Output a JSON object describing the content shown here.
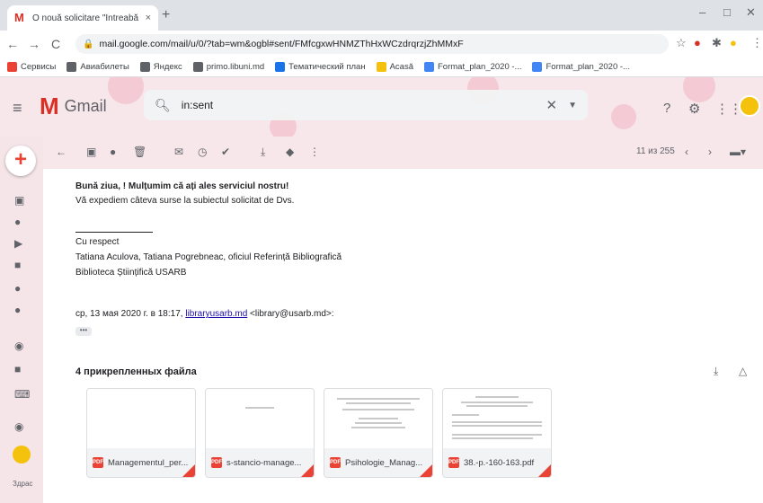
{
  "browser": {
    "tab_title": "O nouă solicitare \"Întreabă bibliot",
    "tab_close": "×",
    "new_tab": "+",
    "url": "mail.google.com/mail/u/0/?tab=wm&ogbl#sent/FMfcgxwHNMZThHxWCzdrqrzjZhMMxF",
    "back": "←",
    "forward": "→",
    "reload": "C",
    "minimize": "–",
    "maximize": "□",
    "close": "✕"
  },
  "bookmarks": [
    {
      "label": "Сервисы",
      "color": "#ea4335"
    },
    {
      "label": "Авиабилеты",
      "color": "#5f6368"
    },
    {
      "label": "Яндекс",
      "color": "#5f6368"
    },
    {
      "label": "primo.libuni.md",
      "color": "#5f6368"
    },
    {
      "label": "Тематический план",
      "color": "#1a73e8"
    },
    {
      "label": "Acasă",
      "color": "#f4c20d"
    },
    {
      "label": "Format_plan_2020 -...",
      "color": "#4285f4"
    },
    {
      "label": "Format_plan_2020 -...",
      "color": "#4285f4"
    }
  ],
  "gmail": {
    "logo_letter": "M",
    "logo_word": "Gmail",
    "search_value": "in:sent"
  },
  "toolbar": {
    "count": "11 из 255"
  },
  "message": {
    "line1": "Bună ziua, ! Mulțumim că ați ales serviciul nostru!",
    "line2": "Vă expediem câteva surse la subiectul solicitat de Dvs.",
    "regards": "Cu respect",
    "names": "Tatiana Aculova, Tatiana Pogrebneac, oficiul Referință Bibliografică",
    "library": "Biblioteca Științifică USARB",
    "quote_prefix": "ср, 13 мая 2020 г. в 18:17,",
    "quote_link": "libraryusarb.md",
    "quote_suffix": "<library@usarb.md>:",
    "dots": "•••"
  },
  "attachments": {
    "header": "4 прикрепленных файла",
    "items": [
      {
        "name": "Managementul_per..."
      },
      {
        "name": "s-stancio-manage..."
      },
      {
        "name": "Psihologie_Manag..."
      },
      {
        "name": "38.-p.-160-163.pdf"
      }
    ]
  },
  "rail": {
    "label": "Здрас"
  }
}
